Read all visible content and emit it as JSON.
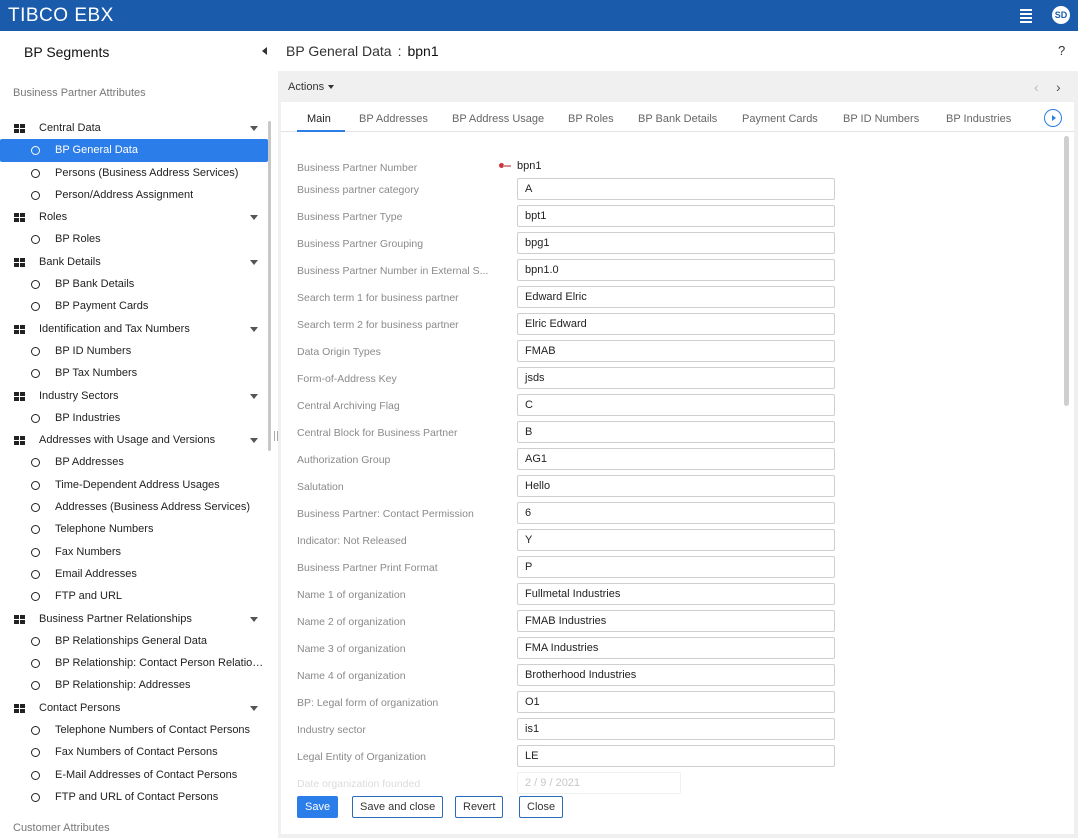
{
  "app": {
    "logo": "TIBCO EBX",
    "user_initials": "SD"
  },
  "sidebar": {
    "title": "BP Segments",
    "section1": "Business Partner Attributes",
    "section2": "Customer Attributes",
    "tree": [
      {
        "type": "group",
        "label": "Central Data"
      },
      {
        "type": "item",
        "label": "BP General Data",
        "selected": true
      },
      {
        "type": "item",
        "label": "Persons (Business Address Services)"
      },
      {
        "type": "item",
        "label": "Person/Address Assignment"
      },
      {
        "type": "group",
        "label": "Roles"
      },
      {
        "type": "item",
        "label": "BP Roles"
      },
      {
        "type": "group",
        "label": "Bank Details"
      },
      {
        "type": "item",
        "label": "BP Bank Details"
      },
      {
        "type": "item",
        "label": "BP Payment Cards"
      },
      {
        "type": "group",
        "label": "Identification and Tax Numbers"
      },
      {
        "type": "item",
        "label": "BP ID Numbers"
      },
      {
        "type": "item",
        "label": "BP Tax Numbers"
      },
      {
        "type": "group",
        "label": "Industry Sectors"
      },
      {
        "type": "item",
        "label": "BP Industries"
      },
      {
        "type": "group",
        "label": "Addresses with Usage and Versions"
      },
      {
        "type": "item",
        "label": "BP Addresses"
      },
      {
        "type": "item",
        "label": "Time-Dependent Address Usages"
      },
      {
        "type": "item",
        "label": "Addresses (Business Address Services)"
      },
      {
        "type": "item",
        "label": "Telephone Numbers"
      },
      {
        "type": "item",
        "label": "Fax Numbers"
      },
      {
        "type": "item",
        "label": "Email Addresses"
      },
      {
        "type": "item",
        "label": "FTP and URL"
      },
      {
        "type": "group",
        "label": "Business Partner Relationships"
      },
      {
        "type": "item",
        "label": "BP Relationships General Data"
      },
      {
        "type": "item",
        "label": "BP Relationship: Contact Person Relation..."
      },
      {
        "type": "item",
        "label": "BP Relationship: Addresses"
      },
      {
        "type": "group",
        "label": "Contact Persons"
      },
      {
        "type": "item",
        "label": "Telephone Numbers of Contact Persons"
      },
      {
        "type": "item",
        "label": "Fax Numbers of Contact Persons"
      },
      {
        "type": "item",
        "label": "E-Mail Addresses of Contact Persons"
      },
      {
        "type": "item",
        "label": "FTP and URL of Contact Persons"
      }
    ]
  },
  "main": {
    "title": "BP General Data",
    "separator": ":",
    "record": "bpn1",
    "help": "?",
    "actions": "Actions",
    "tabs": [
      "Main",
      "BP Addresses",
      "BP Address Usage",
      "BP Roles",
      "BP Bank Details",
      "Payment Cards",
      "BP ID Numbers",
      "BP Industries"
    ],
    "key_field": {
      "label": "Business Partner Number",
      "value": "bpn1"
    },
    "fields": [
      {
        "label": "Business partner category",
        "value": "A"
      },
      {
        "label": "Business Partner Type",
        "value": "bpt1"
      },
      {
        "label": "Business Partner Grouping",
        "value": "bpg1"
      },
      {
        "label": "Business Partner Number in External S...",
        "value": "bpn1.0"
      },
      {
        "label": "Search term 1 for business partner",
        "value": "Edward Elric"
      },
      {
        "label": "Search term 2 for business partner",
        "value": "Elric Edward"
      },
      {
        "label": "Data Origin Types",
        "value": "FMAB"
      },
      {
        "label": "Form-of-Address Key",
        "value": "jsds"
      },
      {
        "label": "Central Archiving Flag",
        "value": "C"
      },
      {
        "label": "Central Block for Business Partner",
        "value": "B"
      },
      {
        "label": "Authorization Group",
        "value": "AG1"
      },
      {
        "label": "Salutation",
        "value": "Hello"
      },
      {
        "label": "Business Partner: Contact Permission",
        "value": "6"
      },
      {
        "label": "Indicator: Not Released",
        "value": "Y"
      },
      {
        "label": "Business Partner Print Format",
        "value": "P"
      },
      {
        "label": "Name 1 of organization",
        "value": "Fullmetal Industries"
      },
      {
        "label": "Name 2 of organization",
        "value": "FMAB Industries"
      },
      {
        "label": "Name 3 of organization",
        "value": "FMA Industries"
      },
      {
        "label": "Name 4 of organization",
        "value": "Brotherhood Industries"
      },
      {
        "label": "BP: Legal form of organization",
        "value": "O1"
      },
      {
        "label": "Industry sector",
        "value": "is1"
      },
      {
        "label": "Legal Entity of Organization",
        "value": "LE"
      }
    ],
    "date_field": {
      "label": "Date organization founded",
      "value": "2 / 9 / 2021"
    },
    "buttons": {
      "save": "Save",
      "save_close": "Save and close",
      "revert": "Revert",
      "close": "Close"
    }
  },
  "colors": {
    "topbar": "#1a5cab",
    "accent": "#2b7de9"
  }
}
